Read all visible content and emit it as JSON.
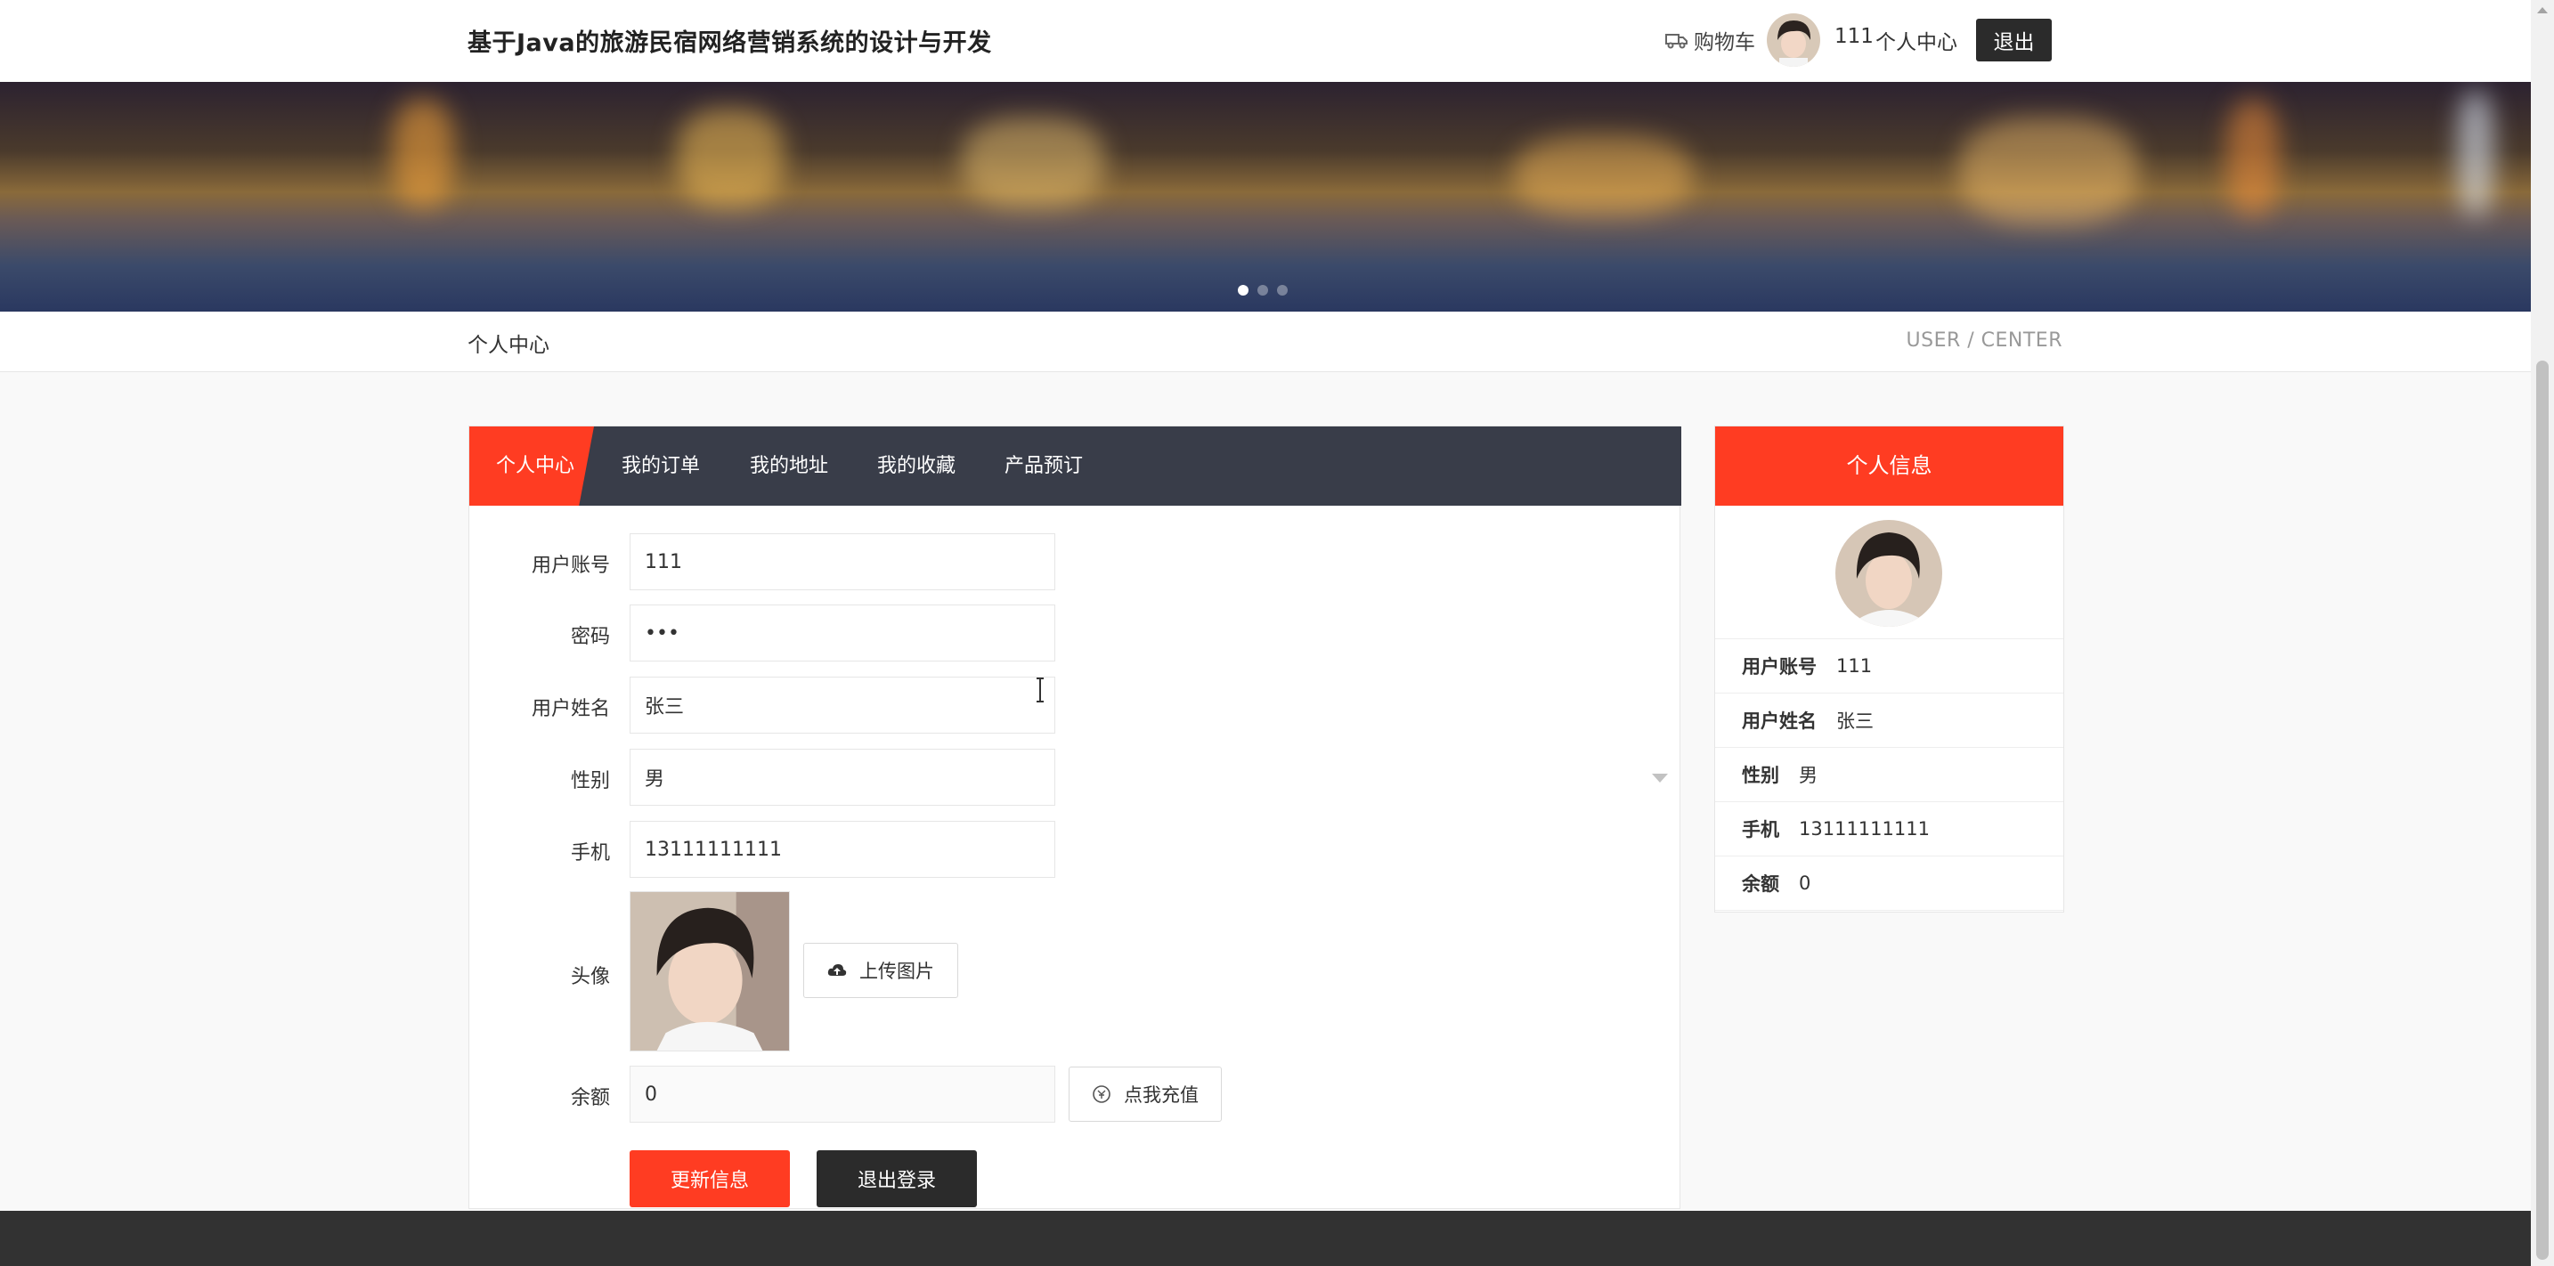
{
  "header": {
    "site_title": "基于Java的旅游民宿网络营销系统的设计与开发",
    "cart_label": "购物车",
    "username": "111",
    "center_label": "个人中心",
    "logout_label": "退出"
  },
  "banner": {
    "slides": 3,
    "active_slide": 1
  },
  "breadcrumb": {
    "left": "个人中心",
    "right": "USER / CENTER"
  },
  "tabs": [
    {
      "label": "个人中心",
      "active": true
    },
    {
      "label": "我的订单",
      "active": false
    },
    {
      "label": "我的地址",
      "active": false
    },
    {
      "label": "我的收藏",
      "active": false
    },
    {
      "label": "产品预订",
      "active": false
    }
  ],
  "form": {
    "account": {
      "label": "用户账号",
      "value": "111"
    },
    "password": {
      "label": "密码",
      "value": "•••"
    },
    "name": {
      "label": "用户姓名",
      "value": "张三"
    },
    "gender": {
      "label": "性别",
      "value": "男"
    },
    "phone": {
      "label": "手机",
      "value": "13111111111"
    },
    "avatar": {
      "label": "头像",
      "upload_label": "上传图片"
    },
    "balance": {
      "label": "余额",
      "value": "0",
      "recharge_label": "点我充值"
    },
    "update_label": "更新信息",
    "logout_label": "退出登录"
  },
  "info_card": {
    "title": "个人信息",
    "rows": [
      {
        "key": "用户账号",
        "value": "111"
      },
      {
        "key": "用户姓名",
        "value": "张三"
      },
      {
        "key": "性别",
        "value": "男"
      },
      {
        "key": "手机",
        "value": "13111111111"
      },
      {
        "key": "余额",
        "value": "0"
      }
    ]
  },
  "colors": {
    "accent": "#ff3c22",
    "tab_bar": "#393d49",
    "dark_button": "#2b2b2b",
    "footer": "#323232"
  }
}
